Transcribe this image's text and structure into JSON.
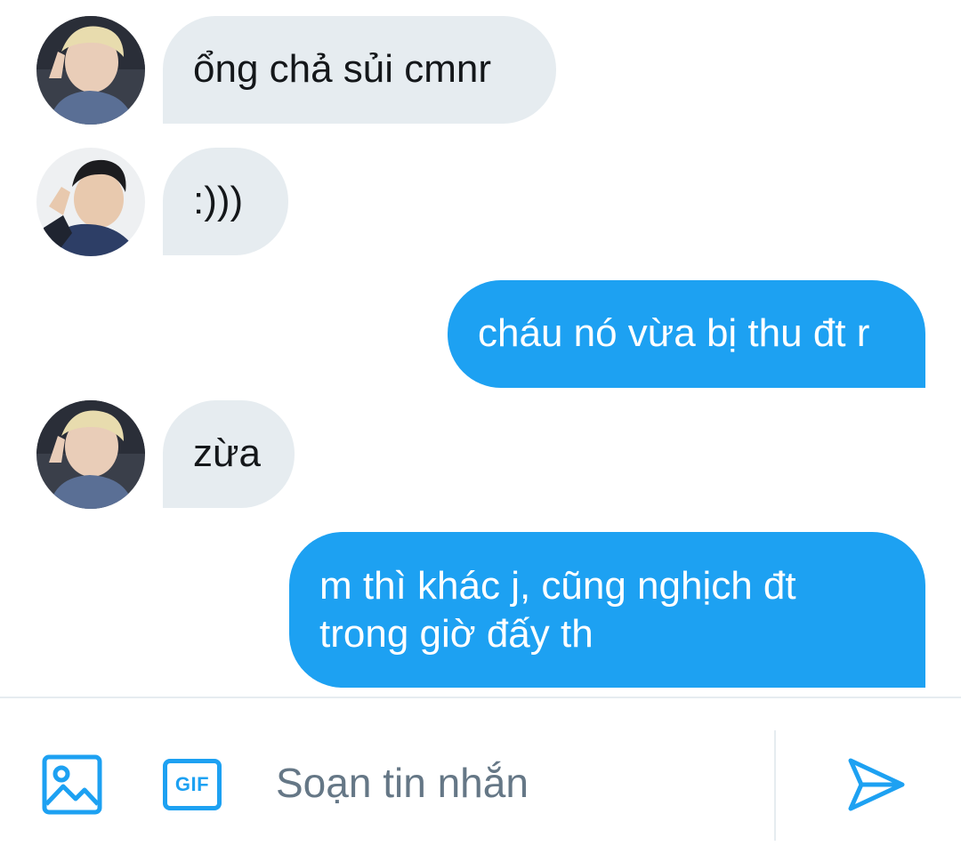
{
  "conversation": {
    "messages": [
      {
        "direction": "incoming",
        "avatar": "avatar-blonde",
        "text": "ổng chả sủi cmnr"
      },
      {
        "direction": "incoming",
        "avatar": "avatar-darkhair",
        "text": ":)))"
      },
      {
        "direction": "outgoing",
        "text": "cháu nó vừa bị thu đt r"
      },
      {
        "direction": "incoming",
        "avatar": "avatar-blonde",
        "text": "zừa"
      },
      {
        "direction": "outgoing",
        "lines": [
          "m thì khác j, cũng nghịch đt",
          "trong giờ đấy th"
        ]
      }
    ]
  },
  "composer": {
    "photo_icon": "image-icon",
    "gif_label": "GIF",
    "placeholder": "Soạn tin nhắn",
    "value": "",
    "send_icon": "send-icon"
  },
  "colors": {
    "accent": "#1da1f2",
    "incoming_bubble": "#e6ecf0",
    "outgoing_bubble": "#1da1f2",
    "text_dark": "#14171a",
    "placeholder": "#657786"
  }
}
